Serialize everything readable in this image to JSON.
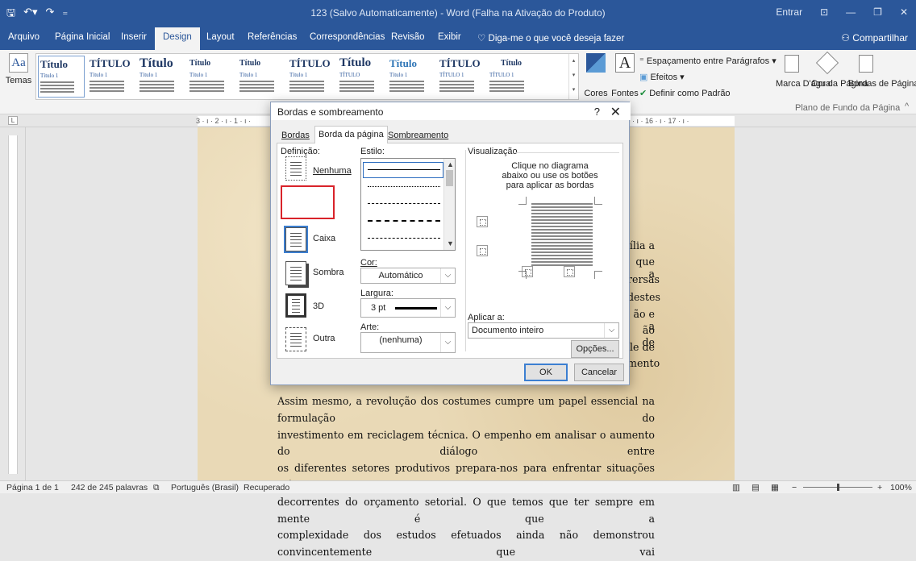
{
  "titlebar": {
    "title": "123 (Salvo Automaticamente)  -  Word (Falha na Ativação do Produto)",
    "sign_in": "Entrar",
    "quick_access": [
      "save-icon",
      "undo-icon",
      "redo-icon",
      "customize-icon"
    ]
  },
  "tabs": [
    "Arquivo",
    "Página Inicial",
    "Inserir",
    "Design",
    "Layout",
    "Referências",
    "Correspondências",
    "Revisão",
    "Exibir"
  ],
  "active_tab": "Design",
  "tell_me": "Diga-me o que você deseja fazer",
  "share": "Compartilhar",
  "ribbon": {
    "temas": "Temas",
    "styles": [
      {
        "title": "Título",
        "sub": "Título 1"
      },
      {
        "title": "TÍTULO",
        "sub": "Título 1"
      },
      {
        "title": "Título",
        "sub": "Título 1"
      },
      {
        "title": "Título",
        "sub": "Título 1"
      },
      {
        "title": "Título",
        "sub": "Título 1"
      },
      {
        "title": "TÍTULO",
        "sub": "Título 1"
      },
      {
        "title": "Título",
        "sub": "TÍTULO"
      },
      {
        "title": "Título",
        "sub": "Título 1"
      },
      {
        "title": "TÍTULO",
        "sub": "TÍTULO 1"
      },
      {
        "title": "Título",
        "sub": "TÍTULO 1"
      }
    ],
    "cores": "Cores",
    "fontes": "Fontes",
    "font_glyph": "A",
    "espacamento": "Espaçamento entre Parágrafos",
    "efeitos": "Efeitos",
    "definir_padrao": "Definir como Padrão",
    "marca_dagua": "Marca D'água",
    "cor_da_pagina": "Cor da Página",
    "bordas_de_pagina": "Bordas de Página",
    "group_background": "Plano de Fundo da Página"
  },
  "ruler_h": "3 · ı · 2 · ı · 1 · ı ·",
  "ruler_h_right": "· ı · 16 · ı · 17 · ı ·",
  "dialog": {
    "title": "Bordas e sombreamento",
    "help": "?",
    "close": "✕",
    "tabs": [
      "Bordas",
      "Borda da página",
      "Sombreamento"
    ],
    "active_tab": "Borda da página",
    "definicao_label": "Definição:",
    "settings": [
      "Nenhuma",
      "Caixa",
      "Sombra",
      "3D",
      "Outra"
    ],
    "selected_setting": "Caixa",
    "estilo_label": "Estilo:",
    "cor_label": "Cor:",
    "cor_value": "Automático",
    "largura_label": "Largura:",
    "largura_value": "3 pt",
    "arte_label": "Arte:",
    "arte_value": "(nenhuma)",
    "visualizacao_label": "Visualização",
    "preview_hint": "Clique no diagrama abaixo ou use os botões para aplicar as bordas",
    "aplicar_label": "Aplicar a:",
    "aplicar_value": "Documento inteiro",
    "opcoes": "Opções...",
    "ok": "OK",
    "cancel": "Cancelar"
  },
  "document": {
    "right_fragments": [
      "ília a",
      "que a",
      "rersas",
      "destes",
      "ão e a",
      "ão de",
      "le de",
      "mento"
    ],
    "paragraph": [
      "Assim mesmo, a revolução dos costumes cumpre um papel essencial na formulação do",
      "investimento em reciclagem técnica. O empenho em analisar o aumento do diálogo entre",
      "os diferentes setores produtivos prepara-nos para enfrentar situações atípicas",
      "decorrentes do orçamento setorial. O que temos que ter sempre em mente é que a",
      "complexidade dos estudos efetuados ainda não demonstrou convincentemente que vai"
    ]
  },
  "status": {
    "page": "Página 1 de 1",
    "words": "242 de 245 palavras",
    "language": "Português (Brasil)",
    "recovered": "Recuperado",
    "zoom": "100%"
  }
}
